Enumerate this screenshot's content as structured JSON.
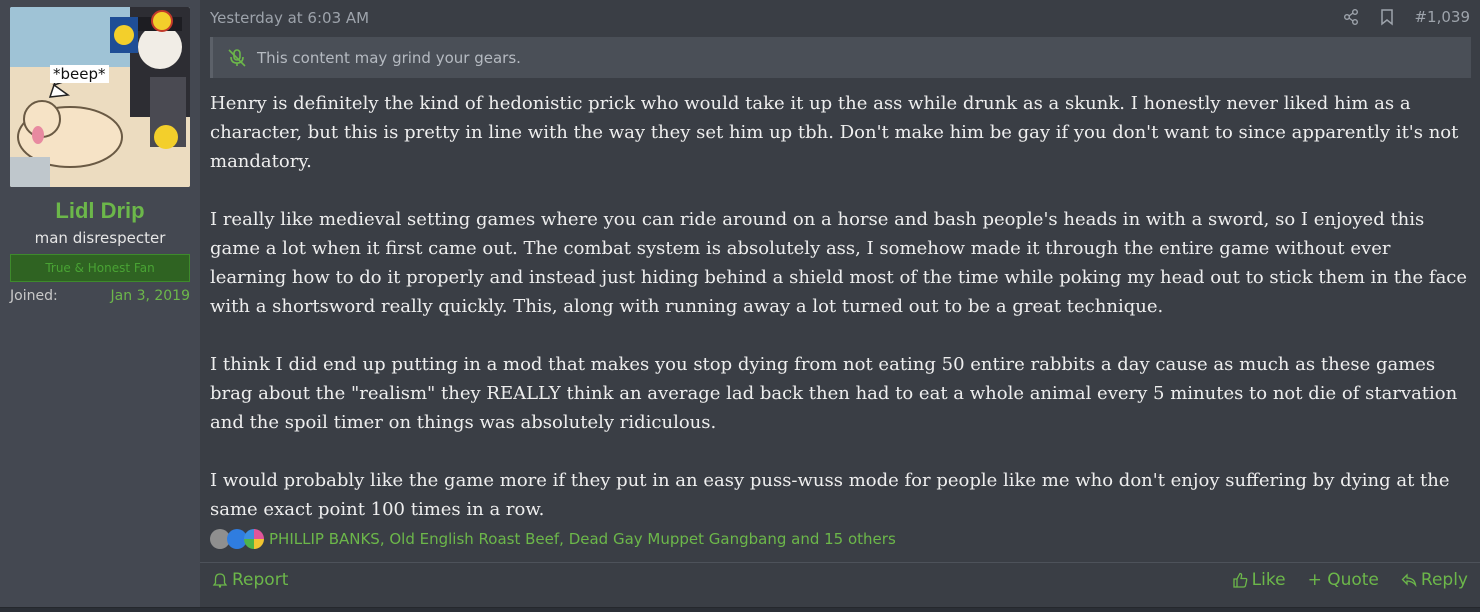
{
  "user": {
    "name": "Lidl Drip",
    "title": "man disrespecter",
    "banner": "True & Honest Fan",
    "joined_label": "Joined:",
    "joined_value": "Jan 3, 2019",
    "avatar_text": "*beep*"
  },
  "post": {
    "date": "Yesterday at 6:03 AM",
    "number": "#1,039",
    "spoiler_text": "This content may grind your gears.",
    "paragraphs": [
      "Henry is definitely the kind of hedonistic prick who would take it up the ass while drunk as a skunk. I honestly never liked him as a character, but this is pretty in line with the way they set him up tbh. Don't make him be gay if you don't want to since apparently it's not mandatory.",
      "I really like medieval setting games where you can ride around on a horse and bash people's heads in with a sword, so I enjoyed this game a lot when it first came out. The combat system is absolutely ass, I somehow made it through the entire game without ever learning how to do it properly and instead just hiding behind a shield most of the time while poking my head out to stick them in the face with a shortsword really quickly. This, along with running away a lot turned out to be a great technique.",
      "I think I did end up putting in a mod that makes you stop dying from not eating 50 entire rabbits a day cause as much as these games brag about the \"realism\" they REALLY think an average lad back then had to eat a whole animal every 5 minutes to not die of starvation and the spoil timer on things was absolutely ridiculous.",
      "I would probably like the game more if they put in an easy puss-wuss mode for people like me who don't enjoy suffering by dying at the same exact point 100 times in a row."
    ],
    "reactions_text": "PHILLIP BANKS, Old English Roast Beef, Dead Gay Muppet Gangbang and 15 others"
  },
  "actions": {
    "report": "Report",
    "like": "Like",
    "quote": "+ Quote",
    "reply": "Reply"
  },
  "colors": {
    "accent": "#6cb74a",
    "post_bg": "#3a3e45",
    "user_col_bg": "#444851"
  },
  "icons": [
    "share-icon",
    "bookmark-icon",
    "muted-mic-icon",
    "report-bell-icon",
    "thumbs-up-icon",
    "reply-arrow-icon"
  ]
}
